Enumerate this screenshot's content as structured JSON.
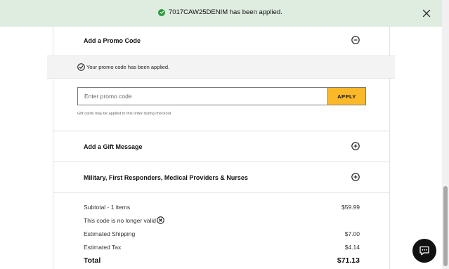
{
  "toast": {
    "message": "7017CAW25DENIM has been applied."
  },
  "promo_section": {
    "title": "Add a Promo Code",
    "notice": "Your promo code has been applied.",
    "input_placeholder": "Enter promo code",
    "apply_label": "APPLY",
    "gift_note": "Gift cards may be applied to this order during checkout."
  },
  "gift_message": {
    "title": "Add a Gift Message"
  },
  "military": {
    "title": "Military, First Responders, Medical Providers & Nurses"
  },
  "summary": {
    "subtotal_label": "Subtotal - 1 items",
    "subtotal_value": "$59.99",
    "invalid_label": "This code is no longer valid",
    "shipping_label": "Estimated Shipping",
    "shipping_value": "$7.00",
    "tax_label": "Estimated Tax",
    "tax_value": "$4.14",
    "total_label": "Total",
    "total_value": "$71.13"
  },
  "colors": {
    "toast_bg": "#dfece0",
    "toast_check": "#2e9a3e",
    "apply_button": "#fbb829",
    "notice_bg": "#f3f3f3"
  },
  "icons": {
    "toast": "check-circle-icon",
    "close": "close-icon",
    "promo_toggle": "minus-circle-icon",
    "gift_toggle": "plus-circle-icon",
    "military_toggle": "plus-circle-icon",
    "notice": "check-circle-outline-icon",
    "invalid": "x-circle-icon",
    "chat": "chat-icon"
  }
}
